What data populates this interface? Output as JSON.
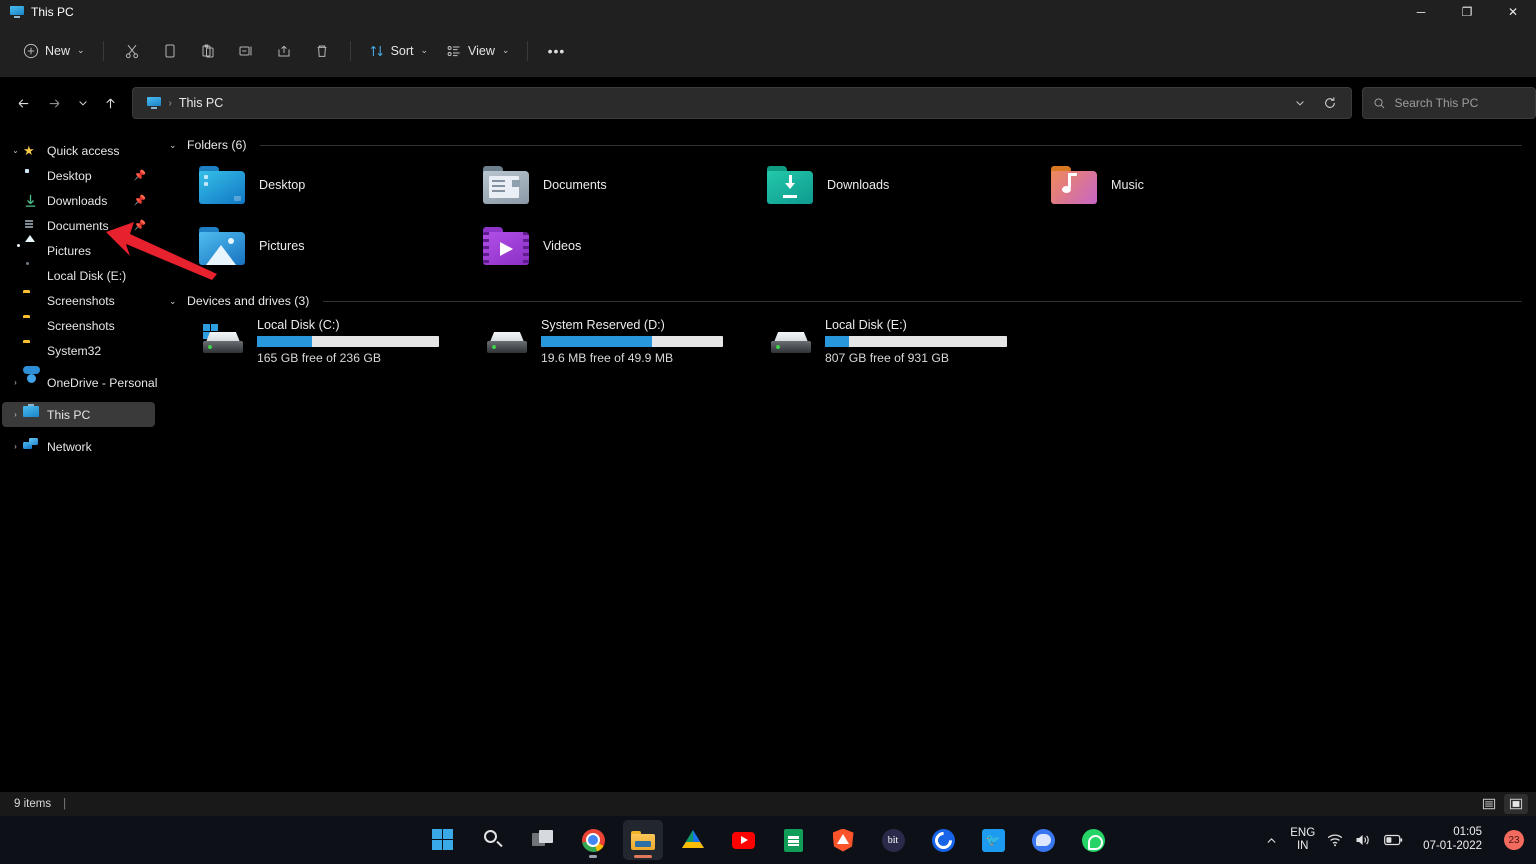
{
  "window": {
    "title": "This PC",
    "title_icon": "monitor-icon",
    "controls": {
      "minimize": "─",
      "maximize": "❐",
      "close": "✕"
    }
  },
  "toolbar": {
    "new_label": "New",
    "new_icon": "plus-circle-icon",
    "icon_buttons": [
      {
        "name": "cut-button",
        "icon": "scissors-icon"
      },
      {
        "name": "copy-button",
        "icon": "copy-icon"
      },
      {
        "name": "paste-button",
        "icon": "clipboard-icon"
      },
      {
        "name": "rename-button",
        "icon": "rename-icon"
      },
      {
        "name": "share-button",
        "icon": "share-icon"
      },
      {
        "name": "delete-button",
        "icon": "trash-icon"
      }
    ],
    "sort_label": "Sort",
    "sort_icon": "sort-arrows-icon",
    "view_label": "View",
    "view_icon": "view-list-icon",
    "more_label": "•••",
    "chevron": "⌄"
  },
  "addressbar": {
    "back_icon": "arrow-left-icon",
    "forward_icon": "arrow-right-icon",
    "recent_icon": "chevron-down-icon",
    "up_icon": "arrow-up-icon",
    "breadcrumb_icon": "monitor-icon",
    "breadcrumb_text": "This PC",
    "breadcrumb_separator": "›",
    "dropdown_icon": "chevron-down-icon",
    "refresh_icon": "refresh-icon",
    "search_icon": "search-icon",
    "search_placeholder": "Search This PC",
    "search_value": ""
  },
  "sidebar": {
    "groups": [
      {
        "name": "quick-access",
        "label": "Quick access",
        "icon": "star-icon",
        "expanded": true,
        "chevron": "⌄",
        "items": [
          {
            "label": "Desktop",
            "icon": "desktop-folder-icon",
            "pinned": true
          },
          {
            "label": "Downloads",
            "icon": "downloads-arrow-icon",
            "pinned": true
          },
          {
            "label": "Documents",
            "icon": "documents-icon",
            "pinned": true
          },
          {
            "label": "Pictures",
            "icon": "pictures-icon",
            "pinned": false
          },
          {
            "label": "Local Disk (E:)",
            "icon": "drive-icon",
            "pinned": false
          },
          {
            "label": "Screenshots",
            "icon": "folder-icon",
            "pinned": false
          },
          {
            "label": "Screenshots",
            "icon": "folder-icon",
            "pinned": false
          },
          {
            "label": "System32",
            "icon": "folder-icon",
            "pinned": false
          }
        ]
      }
    ],
    "roots": [
      {
        "label": "OneDrive - Personal",
        "icon": "onedrive-cloud-icon",
        "chevron": "›",
        "selected": false
      },
      {
        "label": "This PC",
        "icon": "monitor-icon",
        "chevron": "›",
        "selected": true
      },
      {
        "label": "Network",
        "icon": "network-icon",
        "chevron": "›",
        "selected": false
      }
    ],
    "pin_glyph": "📌"
  },
  "content": {
    "folders_group": {
      "label": "Folders (6)",
      "chevron": "⌄",
      "items": [
        {
          "label": "Desktop",
          "icon": "desktop-folder-icon"
        },
        {
          "label": "Documents",
          "icon": "documents-folder-icon"
        },
        {
          "label": "Downloads",
          "icon": "downloads-folder-icon"
        },
        {
          "label": "Music",
          "icon": "music-folder-icon"
        },
        {
          "label": "Pictures",
          "icon": "pictures-folder-icon"
        },
        {
          "label": "Videos",
          "icon": "videos-folder-icon"
        }
      ]
    },
    "drives_group": {
      "label": "Devices and drives (3)",
      "chevron": "⌄",
      "items": [
        {
          "name": "Local Disk (C:)",
          "free_text": "165 GB free of 236 GB",
          "used_percent": 30,
          "has_windows_logo": true,
          "bar_color": "#2897db"
        },
        {
          "name": "System Reserved (D:)",
          "free_text": "19.6 MB free of 49.9 MB",
          "used_percent": 61,
          "has_windows_logo": false,
          "bar_color": "#2897db"
        },
        {
          "name": "Local Disk (E:)",
          "free_text": "807 GB free of 931 GB",
          "used_percent": 13,
          "has_windows_logo": false,
          "bar_color": "#2897db"
        }
      ]
    }
  },
  "annotation": {
    "type": "red-arrow",
    "color": "#e8212f",
    "points_to": "Documents"
  },
  "statusbar": {
    "item_count": "9 items",
    "divider": "|",
    "view_details_icon": "details-view-icon",
    "view_large_icon": "large-icons-view-icon"
  },
  "taskbar": {
    "items": [
      {
        "name": "start-button",
        "icon": "windows-logo-icon",
        "label": "Start"
      },
      {
        "name": "search-button",
        "icon": "search-icon",
        "label": "Search"
      },
      {
        "name": "task-view-button",
        "icon": "task-view-icon",
        "label": "Task View"
      },
      {
        "name": "chrome-button",
        "icon": "chrome-icon",
        "label": "Google Chrome",
        "running": true
      },
      {
        "name": "file-explorer-button",
        "icon": "folder-icon",
        "label": "File Explorer",
        "active": true
      },
      {
        "name": "google-drive-button",
        "icon": "google-drive-icon",
        "label": "Google Drive"
      },
      {
        "name": "youtube-button",
        "icon": "youtube-icon",
        "label": "YouTube"
      },
      {
        "name": "sheets-button",
        "icon": "google-sheets-icon",
        "label": "Google Sheets"
      },
      {
        "name": "brave-button",
        "icon": "brave-icon",
        "label": "Brave"
      },
      {
        "name": "bit-button",
        "icon": "bit-icon",
        "label": "bit"
      },
      {
        "name": "cortana-button",
        "icon": "circle-c-icon",
        "label": "C"
      },
      {
        "name": "twitter-button",
        "icon": "twitter-icon",
        "label": "Twitter"
      },
      {
        "name": "signal-button",
        "icon": "signal-icon",
        "label": "Signal"
      },
      {
        "name": "whatsapp-button",
        "icon": "whatsapp-icon",
        "label": "WhatsApp"
      }
    ],
    "tray": {
      "overflow_icon": "chevron-up-icon",
      "language_line1": "ENG",
      "language_line2": "IN",
      "wifi_icon": "wifi-icon",
      "volume_icon": "speaker-icon",
      "battery_icon": "battery-icon",
      "time": "01:05",
      "date": "07-01-2022",
      "notification_count": "23"
    }
  }
}
